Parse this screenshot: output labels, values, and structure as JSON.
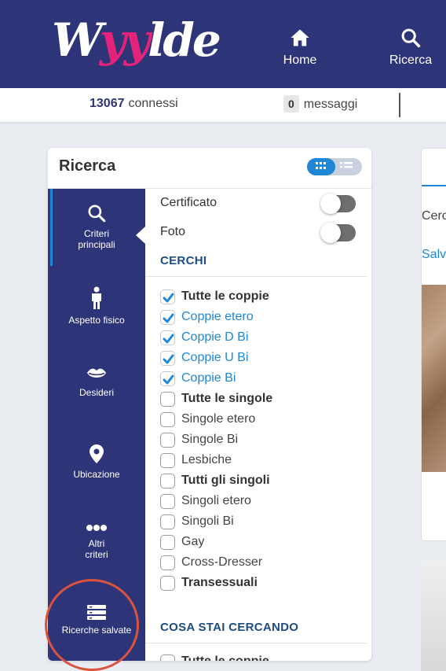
{
  "header": {
    "logo_text_a": "W",
    "logo_text_b": "yy",
    "logo_text_c": "lde",
    "nav": [
      {
        "label": "Home",
        "icon": "home-icon"
      },
      {
        "label": "Ricerca",
        "icon": "search-icon"
      }
    ],
    "bg_color": "#2e3478",
    "accent_pink": "#e3237a"
  },
  "status": {
    "connected_count": "13067",
    "connected_label": "connessi",
    "messages_count": "0",
    "messages_label": "messaggi"
  },
  "card": {
    "title": "Ricerca",
    "view_toggle": {
      "active": "grid",
      "options": [
        "grid",
        "list"
      ]
    }
  },
  "sidebar": {
    "tabs": [
      {
        "label_1": "Criteri",
        "label_2": "principali",
        "icon": "search-icon",
        "active": true
      },
      {
        "label_1": "Aspetto fisico",
        "label_2": "",
        "icon": "person-icon",
        "active": false
      },
      {
        "label_1": "Desideri",
        "label_2": "",
        "icon": "lips-icon",
        "active": false
      },
      {
        "label_1": "Ubicazione",
        "label_2": "",
        "icon": "location-pin-icon",
        "active": false
      },
      {
        "label_1": "Altri",
        "label_2": "criteri",
        "icon": "dots-icon",
        "active": false
      },
      {
        "label_1": "Ricerche salvate",
        "label_2": "",
        "icon": "saved-searches-icon",
        "active": false
      }
    ]
  },
  "filters": {
    "toggles": [
      {
        "label": "Certificato",
        "on": false
      },
      {
        "label": "Foto",
        "on": false
      }
    ],
    "section_cerchi": "CERCHI",
    "options": [
      {
        "label": "Tutte le coppie",
        "checked": true,
        "style": "bold"
      },
      {
        "label": "Coppie etero",
        "checked": true,
        "style": "blue"
      },
      {
        "label": "Coppie D Bi",
        "checked": true,
        "style": "blue"
      },
      {
        "label": "Coppie U Bi",
        "checked": true,
        "style": "blue"
      },
      {
        "label": "Coppie Bi",
        "checked": true,
        "style": "blue"
      },
      {
        "label": "Tutte le singole",
        "checked": false,
        "style": "bold"
      },
      {
        "label": "Singole etero",
        "checked": false,
        "style": "plain"
      },
      {
        "label": "Singole Bi",
        "checked": false,
        "style": "plain"
      },
      {
        "label": "Lesbiche",
        "checked": false,
        "style": "plain"
      },
      {
        "label": "Tutti gli singoli",
        "checked": false,
        "style": "bold"
      },
      {
        "label": "Singoli etero",
        "checked": false,
        "style": "plain"
      },
      {
        "label": "Singoli Bi",
        "checked": false,
        "style": "plain"
      },
      {
        "label": "Gay",
        "checked": false,
        "style": "plain"
      },
      {
        "label": "Cross-Dresser",
        "checked": false,
        "style": "plain"
      },
      {
        "label": "Transessuali",
        "checked": false,
        "style": "bold"
      }
    ],
    "section_cosa": "COSA STAI CERCANDO",
    "next_option_partial": "Tutte le coppie"
  },
  "right_panel": {
    "text1": "Cerc",
    "text2": "Salv"
  }
}
